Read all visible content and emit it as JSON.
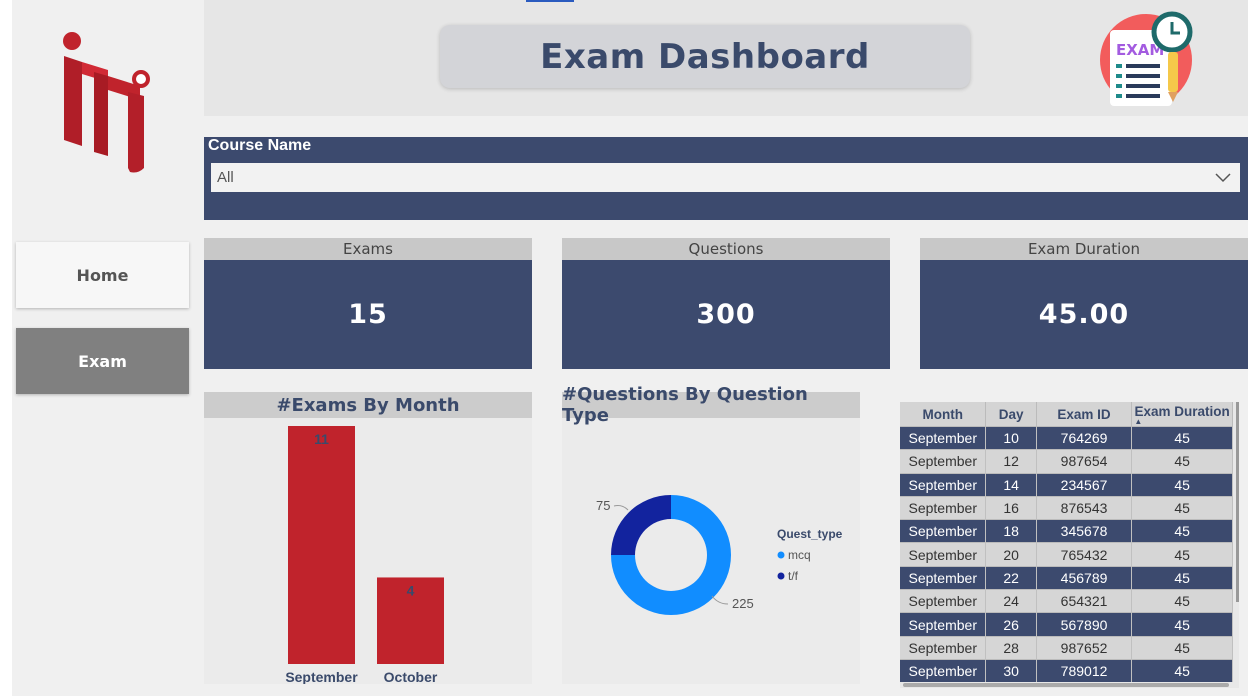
{
  "nav": {
    "home_label": "Home",
    "exam_label": "Exam"
  },
  "header": {
    "title": "Exam Dashboard",
    "icon_text": "EXAM"
  },
  "slicer": {
    "label": "Course Name",
    "value": "All"
  },
  "cards": [
    {
      "label": "Exams",
      "value": "15"
    },
    {
      "label": "Questions",
      "value": "300"
    },
    {
      "label": "Exam Duration",
      "value": "45.00"
    }
  ],
  "exams_chart": {
    "title": "#Exams By Month",
    "chart_data": {
      "type": "bar",
      "categories": [
        "September",
        "October"
      ],
      "values": [
        11,
        4
      ],
      "color": "#c0232c"
    }
  },
  "questions_chart": {
    "title": "#Questions By Question Type",
    "chart_data": {
      "type": "pie",
      "legend_title": "Quest_type",
      "labels": [
        "mcq",
        "t/f"
      ],
      "values": [
        225,
        75
      ],
      "colors": [
        "#118dff",
        "#12239e"
      ]
    }
  },
  "table": {
    "headers": [
      "Month",
      "Day",
      "Exam ID",
      "Exam Duration"
    ],
    "rows": [
      [
        "September",
        "10",
        "764269",
        "45"
      ],
      [
        "September",
        "12",
        "987654",
        "45"
      ],
      [
        "September",
        "14",
        "234567",
        "45"
      ],
      [
        "September",
        "16",
        "876543",
        "45"
      ],
      [
        "September",
        "18",
        "345678",
        "45"
      ],
      [
        "September",
        "20",
        "765432",
        "45"
      ],
      [
        "September",
        "22",
        "456789",
        "45"
      ],
      [
        "September",
        "24",
        "654321",
        "45"
      ],
      [
        "September",
        "26",
        "567890",
        "45"
      ],
      [
        "September",
        "28",
        "987652",
        "45"
      ],
      [
        "September",
        "30",
        "789012",
        "45"
      ]
    ]
  },
  "colors": {
    "navy": "#3c4a6e",
    "bar_red": "#c0232c",
    "mcq_blue": "#118dff",
    "tf_navy": "#12239e"
  }
}
